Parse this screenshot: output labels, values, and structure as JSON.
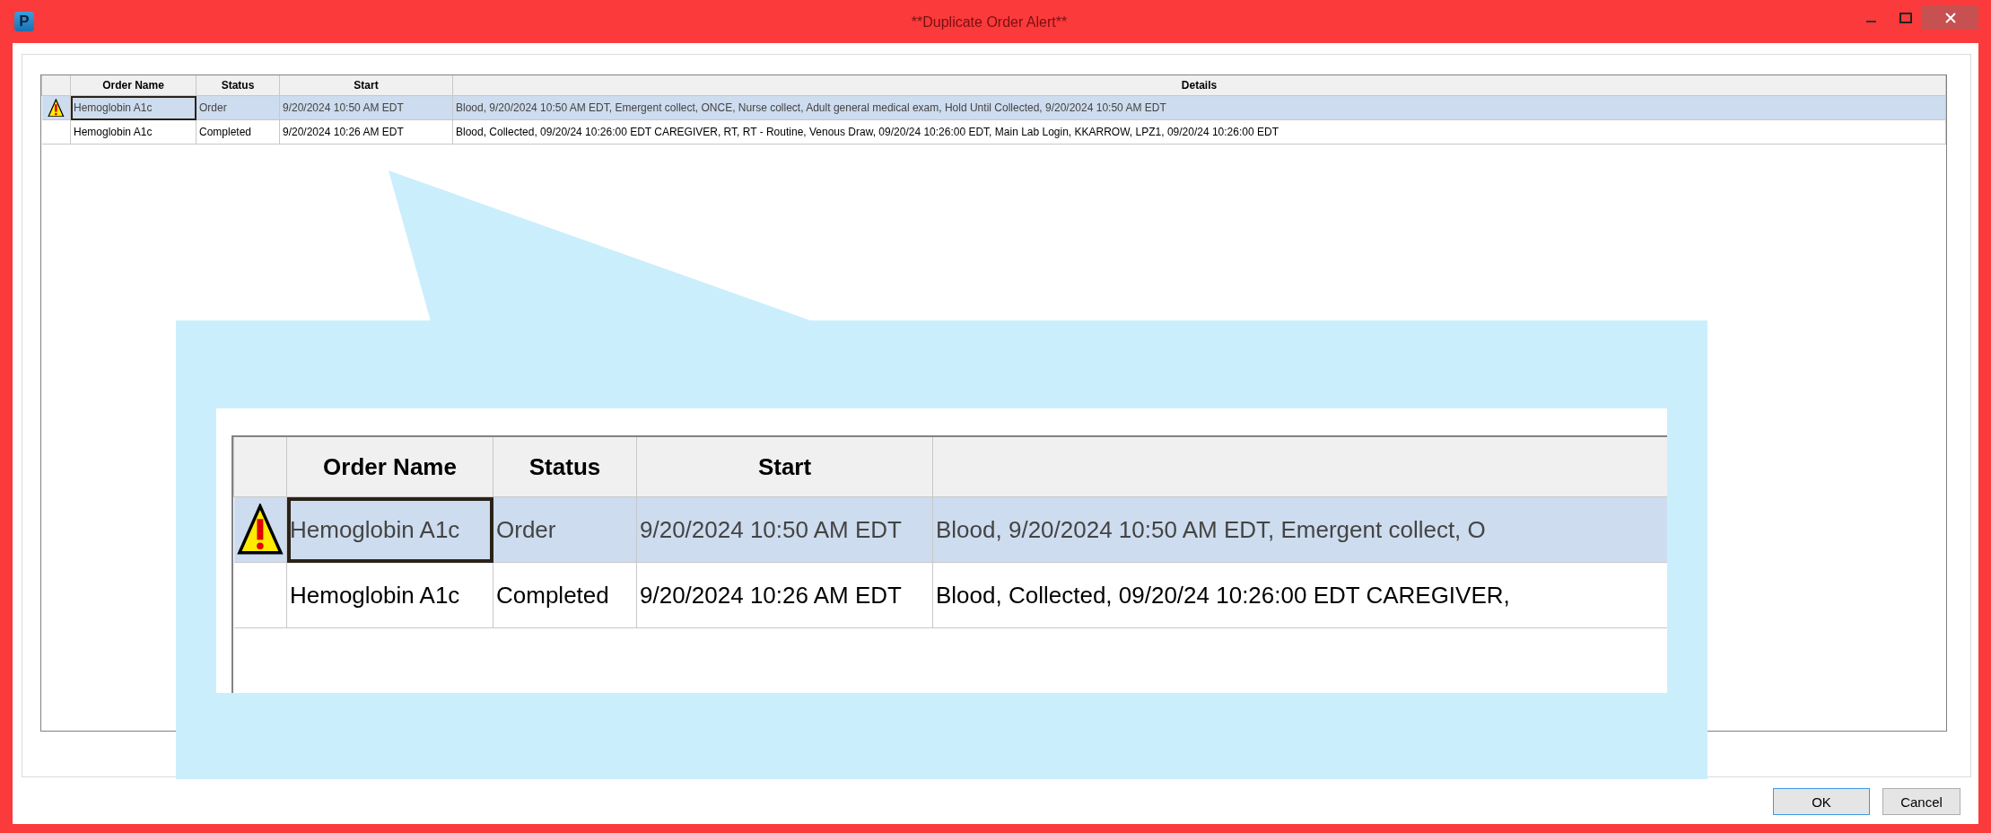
{
  "window": {
    "app_icon": "P",
    "title": "**Duplicate Order Alert**"
  },
  "table": {
    "columns": [
      "Order Name",
      "Status",
      "Start",
      "Details"
    ],
    "rows": [
      {
        "alert": true,
        "selected": true,
        "focused": true,
        "cells": [
          "Hemoglobin A1c",
          "Order",
          "9/20/2024 10:50 AM EDT",
          "Blood, 9/20/2024 10:50 AM EDT, Emergent collect, ONCE, Nurse collect, Adult general medical exam, Hold Until Collected, 9/20/2024 10:50 AM EDT"
        ]
      },
      {
        "alert": false,
        "selected": false,
        "focused": false,
        "cells": [
          "Hemoglobin A1c",
          "Completed",
          "9/20/2024 10:26 AM EDT",
          "Blood, Collected, 09/20/24 10:26:00 EDT CAREGIVER, RT, RT - Routine, Venous Draw, 09/20/24 10:26:00 EDT, Main Lab Login, KKARROW, LPZ1, 09/20/24 10:26:00 EDT"
        ]
      }
    ]
  },
  "callout": {
    "columns": [
      "Order Name",
      "Status",
      "Start"
    ],
    "rows": [
      {
        "alert": true,
        "selected": true,
        "focused": true,
        "cells": [
          "Hemoglobin A1c",
          "Order",
          "9/20/2024 10:50 AM EDT",
          "Blood, 9/20/2024 10:50 AM EDT, Emergent collect, O"
        ]
      },
      {
        "alert": false,
        "selected": false,
        "focused": false,
        "cells": [
          "Hemoglobin A1c",
          "Completed",
          "9/20/2024 10:26 AM EDT",
          "Blood, Collected, 09/20/24 10:26:00 EDT CAREGIVER,"
        ]
      }
    ]
  },
  "buttons": [
    {
      "label": "OK",
      "default": true
    },
    {
      "label": "Cancel",
      "default": false
    }
  ]
}
